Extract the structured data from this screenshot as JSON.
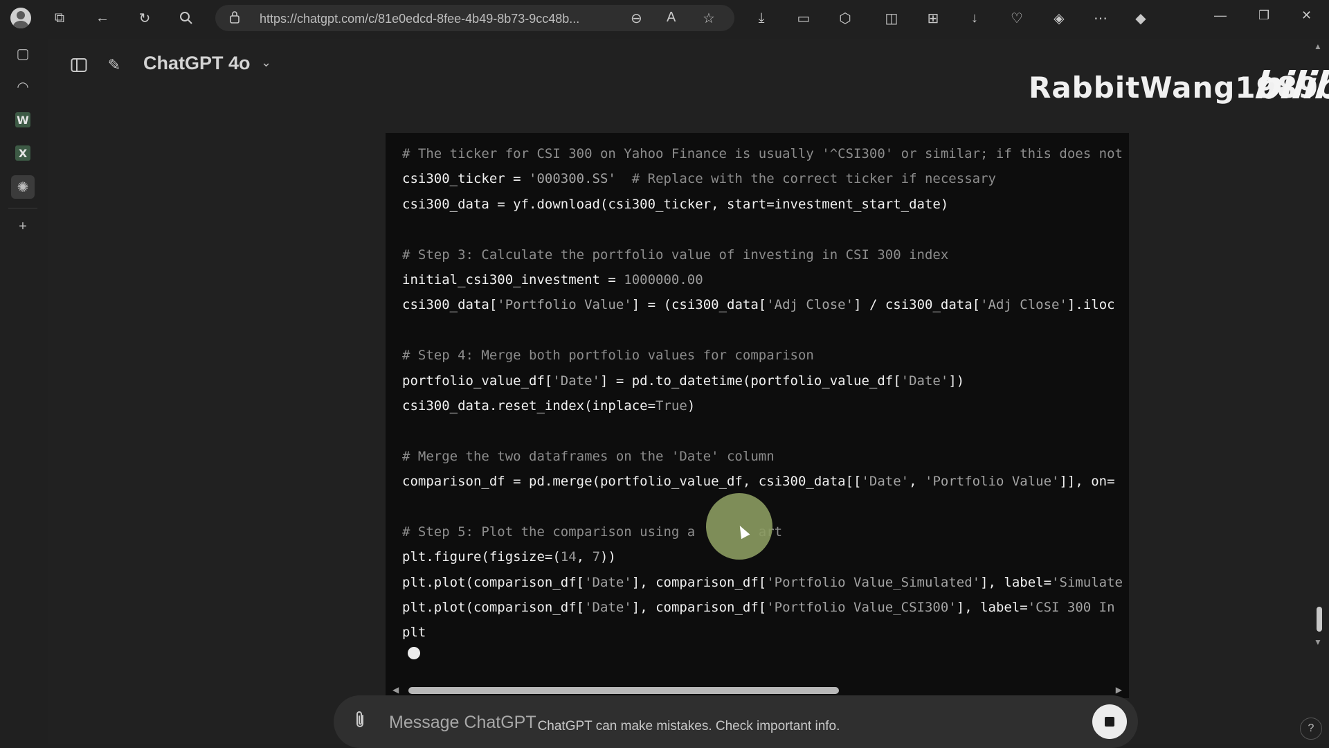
{
  "browser": {
    "url": "https://chatgpt.com/c/81e0edcd-8fee-4b49-8b73-9cc48b...",
    "icons": [
      "profile-icon",
      "workspaces-icon",
      "back-icon",
      "refresh-icon",
      "search-icon",
      "lock-icon",
      "zoom-out-icon",
      "read-aloud-icon",
      "favorite-icon",
      "download-icon",
      "print-icon",
      "extensions-icon",
      "split-screen-icon",
      "collections-icon",
      "downloads-icon",
      "performance-icon",
      "browser-essentials-icon",
      "more-icon",
      "copilot-icon"
    ]
  },
  "sidebar": {
    "items": [
      "tabs-icon",
      "history-icon",
      "word-icon",
      "excel-icon",
      "chatgpt-icon",
      "add-icon"
    ]
  },
  "app": {
    "model_title": "ChatGPT 4o",
    "watermark": "RabbitWang1989",
    "watermark_logo": "bilibili"
  },
  "code": {
    "lines": [
      [
        {
          "t": "# The ticker for CSI 300 on Yahoo Finance is usually '^CSI300' or similar; if this does not",
          "c": "comment"
        }
      ],
      [
        {
          "t": "csi300_ticker = ",
          "c": ""
        },
        {
          "t": "'000300.SS'",
          "c": "str"
        },
        {
          "t": "  # Replace with the correct ticker if necessary",
          "c": "comment"
        }
      ],
      [
        {
          "t": "csi300_data = yf.download(csi300_ticker, start=investment_start_date)",
          "c": ""
        }
      ],
      [
        {
          "t": "",
          "c": ""
        }
      ],
      [
        {
          "t": "# Step 3: Calculate the portfolio value of investing in CSI 300 index",
          "c": "comment"
        }
      ],
      [
        {
          "t": "initial_csi300_investment = ",
          "c": ""
        },
        {
          "t": "1000000.00",
          "c": "num"
        }
      ],
      [
        {
          "t": "csi300_data[",
          "c": ""
        },
        {
          "t": "'Portfolio Value'",
          "c": "str"
        },
        {
          "t": "] = (csi300_data[",
          "c": ""
        },
        {
          "t": "'Adj Close'",
          "c": "str"
        },
        {
          "t": "] / csi300_data[",
          "c": ""
        },
        {
          "t": "'Adj Close'",
          "c": "str"
        },
        {
          "t": "].iloc",
          "c": ""
        }
      ],
      [
        {
          "t": "",
          "c": ""
        }
      ],
      [
        {
          "t": "# Step 4: Merge both portfolio values for comparison",
          "c": "comment"
        }
      ],
      [
        {
          "t": "portfolio_value_df[",
          "c": ""
        },
        {
          "t": "'Date'",
          "c": "str"
        },
        {
          "t": "] = pd.to_datetime(portfolio_value_df[",
          "c": ""
        },
        {
          "t": "'Date'",
          "c": "str"
        },
        {
          "t": "])",
          "c": ""
        }
      ],
      [
        {
          "t": "csi300_data.reset_index(inplace=",
          "c": ""
        },
        {
          "t": "True",
          "c": "kw"
        },
        {
          "t": ")",
          "c": ""
        }
      ],
      [
        {
          "t": "",
          "c": ""
        }
      ],
      [
        {
          "t": "# Merge the two dataframes on the 'Date' column",
          "c": "comment"
        }
      ],
      [
        {
          "t": "comparison_df = pd.merge(portfolio_value_df, csi300_data[[",
          "c": ""
        },
        {
          "t": "'Date'",
          "c": "str"
        },
        {
          "t": ", ",
          "c": ""
        },
        {
          "t": "'Portfolio Value'",
          "c": "str"
        },
        {
          "t": "]], on=",
          "c": ""
        }
      ],
      [
        {
          "t": "",
          "c": ""
        }
      ],
      [
        {
          "t": "# Step 5: Plot the comparison using a        art",
          "c": "comment"
        }
      ],
      [
        {
          "t": "plt.figure(figsize=(",
          "c": ""
        },
        {
          "t": "14",
          "c": "num"
        },
        {
          "t": ", ",
          "c": ""
        },
        {
          "t": "7",
          "c": "num"
        },
        {
          "t": "))",
          "c": ""
        }
      ],
      [
        {
          "t": "plt.plot(comparison_df[",
          "c": ""
        },
        {
          "t": "'Date'",
          "c": "str"
        },
        {
          "t": "], comparison_df[",
          "c": ""
        },
        {
          "t": "'Portfolio Value_Simulated'",
          "c": "str"
        },
        {
          "t": "], label=",
          "c": ""
        },
        {
          "t": "'Simulate",
          "c": "str"
        }
      ],
      [
        {
          "t": "plt.plot(comparison_df[",
          "c": ""
        },
        {
          "t": "'Date'",
          "c": "str"
        },
        {
          "t": "], comparison_df[",
          "c": ""
        },
        {
          "t": "'Portfolio Value_CSI300'",
          "c": "str"
        },
        {
          "t": "], label=",
          "c": ""
        },
        {
          "t": "'CSI 300 In",
          "c": "str"
        }
      ],
      [
        {
          "t": "plt",
          "c": ""
        }
      ]
    ]
  },
  "composer": {
    "placeholder": "Message ChatGPT",
    "value": ""
  },
  "footer": {
    "disclaimer": "ChatGPT can make mistakes. Check important info.",
    "help_label": "?"
  }
}
